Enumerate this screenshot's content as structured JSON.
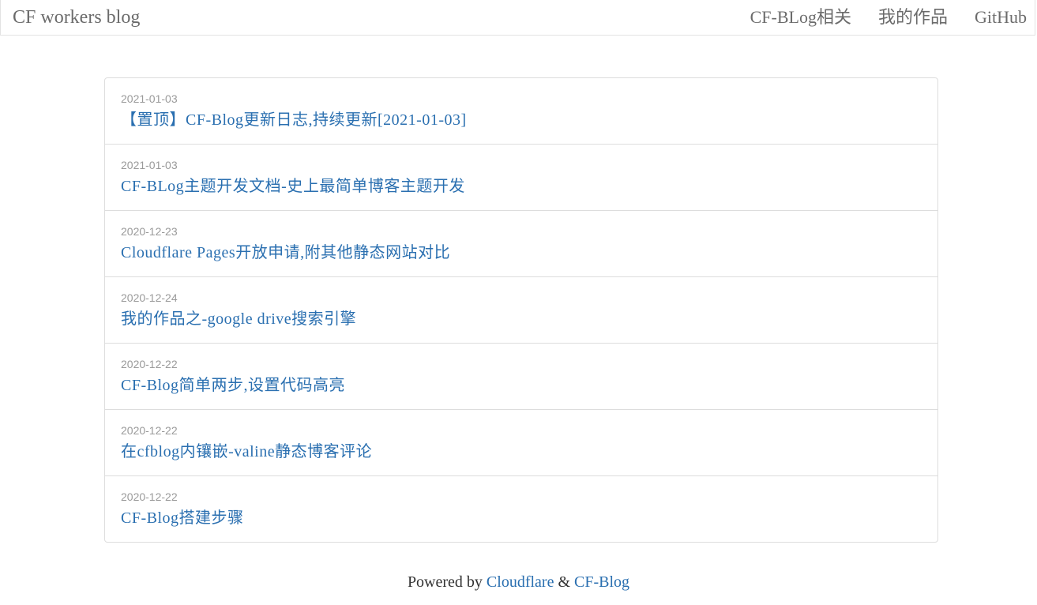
{
  "navbar": {
    "brand": "CF workers blog",
    "links": [
      "CF-BLog相关",
      "我的作品",
      "GitHub"
    ]
  },
  "posts": [
    {
      "date": "2021-01-03",
      "title": "【置顶】CF-Blog更新日志,持续更新[2021-01-03]"
    },
    {
      "date": "2021-01-03",
      "title": "CF-BLog主题开发文档-史上最简单博客主题开发"
    },
    {
      "date": "2020-12-23",
      "title": "Cloudflare Pages开放申请,附其他静态网站对比"
    },
    {
      "date": "2020-12-24",
      "title": "我的作品之-google drive搜索引擎"
    },
    {
      "date": "2020-12-22",
      "title": "CF-Blog简单两步,设置代码高亮"
    },
    {
      "date": "2020-12-22",
      "title": "在cfblog内镶嵌-valine静态博客评论"
    },
    {
      "date": "2020-12-22",
      "title": "CF-Blog搭建步骤"
    }
  ],
  "footer": {
    "powered_by": "Powered by ",
    "link1": "Cloudflare",
    "separator": " & ",
    "link2": "CF-Blog"
  },
  "colors": {
    "link": "#2a6fb0",
    "muted": "#9a9a9a",
    "nav_text": "#6b6b6b",
    "border": "#dddddd"
  }
}
